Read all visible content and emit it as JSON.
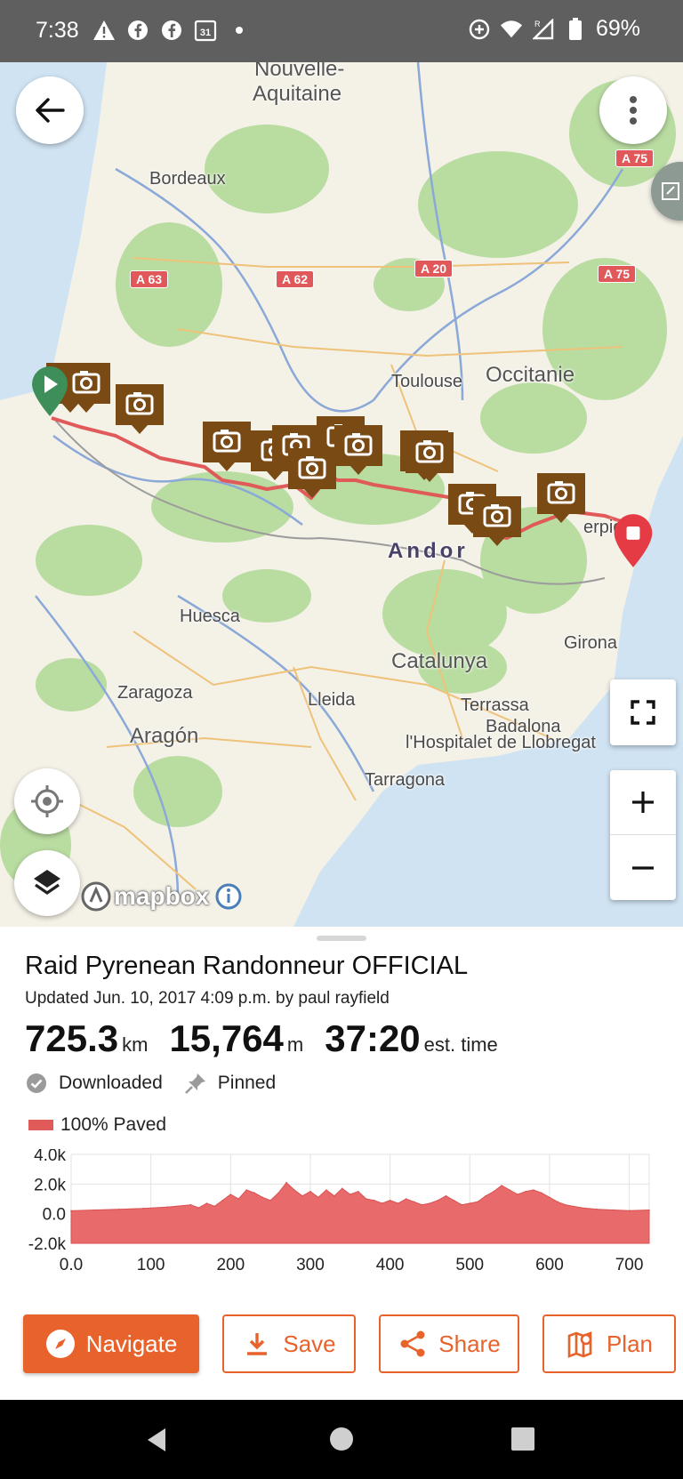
{
  "status_bar": {
    "time": "7:38",
    "battery": "69%"
  },
  "map": {
    "labels": {
      "nouvelle_aquitaine_1": "Nouvelle-",
      "nouvelle_aquitaine_2": "Aquitaine",
      "bordeaux": "Bordeaux",
      "toulouse": "Toulouse",
      "occitanie": "Occitanie",
      "andorra": "Andor",
      "huesca": "Huesca",
      "catalunya": "Catalunya",
      "zaragoza": "Zaragoza",
      "lleida": "Lleida",
      "aragon": "Aragón",
      "terrassa": "Terrassa",
      "badalona": "Badalona",
      "hospitalet": "l'Hospitalet de Llobregat",
      "tarragona": "Tarragona",
      "girona": "Girona",
      "perpignan_frag": "erpig"
    },
    "roads": [
      "A 63",
      "A 62",
      "A 20",
      "A 75",
      "A 75"
    ],
    "attribution": "mapbox"
  },
  "route": {
    "title": "Raid Pyrenean Randonneur OFFICIAL",
    "updated": "Updated Jun. 10, 2017 4:09 p.m. by paul rayfield",
    "distance_value": "725.3",
    "distance_unit": "km",
    "elevation_value": "15,764",
    "elevation_unit": "m",
    "time_value": "37:20",
    "time_unit": "est. time",
    "downloaded": "Downloaded",
    "pinned": "Pinned",
    "surface": "100% Paved",
    "route_color": "#e05a5a"
  },
  "chart_data": {
    "type": "area",
    "y_ticks": [
      "4.0k",
      "2.0k",
      "0.0",
      "-2.0k"
    ],
    "x_ticks": [
      "0.0",
      "100",
      "200",
      "300",
      "400",
      "500",
      "600",
      "700"
    ],
    "ylim": [
      -2000,
      4000
    ],
    "xlim": [
      0,
      725
    ],
    "grid": true,
    "x": [
      0,
      30,
      60,
      90,
      120,
      150,
      160,
      170,
      180,
      190,
      200,
      210,
      220,
      230,
      240,
      250,
      260,
      270,
      280,
      290,
      300,
      310,
      320,
      330,
      340,
      350,
      360,
      370,
      380,
      390,
      400,
      410,
      420,
      430,
      440,
      450,
      460,
      470,
      480,
      490,
      500,
      510,
      520,
      530,
      540,
      550,
      560,
      570,
      580,
      590,
      600,
      610,
      620,
      640,
      660,
      680,
      700,
      725
    ],
    "y": [
      200,
      250,
      300,
      350,
      450,
      600,
      400,
      700,
      500,
      900,
      1300,
      1000,
      1600,
      1400,
      1100,
      900,
      1400,
      2100,
      1600,
      1200,
      1500,
      1100,
      1600,
      1200,
      1700,
      1300,
      1500,
      1000,
      900,
      700,
      900,
      700,
      1000,
      800,
      600,
      700,
      900,
      1200,
      900,
      600,
      700,
      800,
      1200,
      1500,
      1900,
      1600,
      1300,
      1500,
      1600,
      1400,
      1100,
      800,
      600,
      400,
      300,
      250,
      200,
      250
    ]
  },
  "actions": {
    "navigate": "Navigate",
    "save": "Save",
    "share": "Share",
    "plan": "Plan"
  },
  "colors": {
    "accent": "#e8632b",
    "marker_brown": "#7a4a14",
    "start_green": "#3e8e5a",
    "end_red": "#e53b45"
  }
}
